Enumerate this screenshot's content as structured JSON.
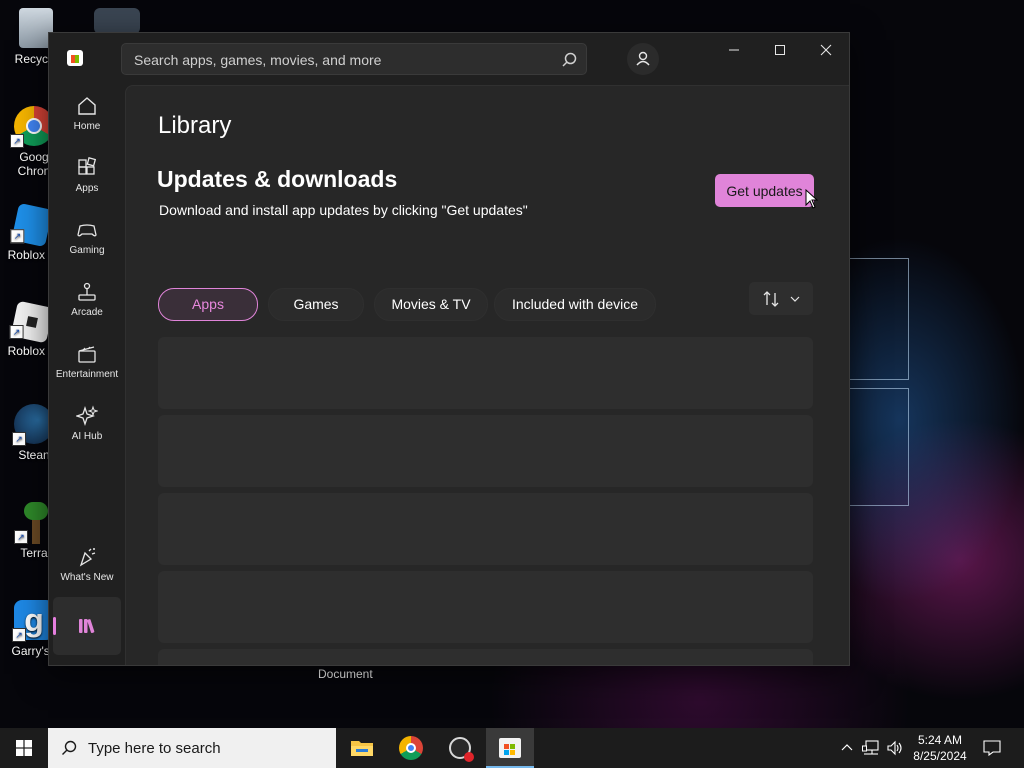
{
  "desktop": {
    "icons": [
      {
        "label": "Recycle"
      },
      {
        "label": "Goog Chron"
      },
      {
        "label": "Roblox S"
      },
      {
        "label": "Roblox P"
      },
      {
        "label": "Stean"
      },
      {
        "label": "Terrar"
      },
      {
        "label": "Garry's I"
      }
    ],
    "document_label": "Document"
  },
  "store": {
    "search": {
      "placeholder": "Search apps, games, movies, and more"
    },
    "nav": [
      {
        "label": "Home",
        "icon": "home-icon"
      },
      {
        "label": "Apps",
        "icon": "apps-icon"
      },
      {
        "label": "Gaming",
        "icon": "gaming-icon"
      },
      {
        "label": "Arcade",
        "icon": "arcade-icon"
      },
      {
        "label": "Entertainment",
        "icon": "entertainment-icon"
      },
      {
        "label": "AI Hub",
        "icon": "ai-hub-icon"
      },
      {
        "label": "What's New",
        "icon": "whats-new-icon"
      }
    ],
    "page_title": "Library",
    "section_title": "Updates & downloads",
    "section_description": "Download and install app updates by clicking \"Get updates\"",
    "get_updates_label": "Get updates",
    "filters": [
      {
        "label": "Apps",
        "active": true
      },
      {
        "label": "Games",
        "active": false
      },
      {
        "label": "Movies & TV",
        "active": false
      },
      {
        "label": "Included with device",
        "active": false
      }
    ],
    "accent_color": "#e084d9"
  },
  "taskbar": {
    "search_placeholder": "Type here to search",
    "apps": [
      "file-explorer-icon",
      "chrome-icon",
      "obs-icon",
      "microsoft-store-icon"
    ],
    "clock": {
      "time": "5:24 AM",
      "date": "8/25/2024"
    }
  }
}
